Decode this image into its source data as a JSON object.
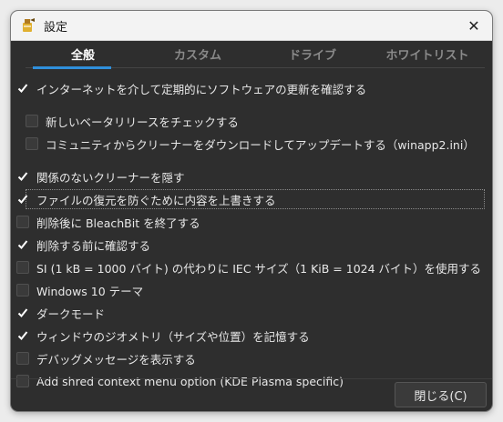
{
  "window": {
    "title": "設定",
    "close_glyph": "✕"
  },
  "tabs": [
    {
      "label": "全般",
      "active": true
    },
    {
      "label": "カスタム",
      "active": false
    },
    {
      "label": "ドライブ",
      "active": false
    },
    {
      "label": "ホワイトリスト",
      "active": false
    }
  ],
  "options": [
    {
      "label": "インターネットを介して定期的にソフトウェアの更新を確認する",
      "checked": true
    },
    {
      "label": "新しいベータリリースをチェックする",
      "checked": false
    },
    {
      "label": "コミュニティからクリーナーをダウンロードしてアップデートする（winapp2.ini）",
      "checked": false
    },
    {
      "label": "関係のないクリーナーを隠す",
      "checked": true
    },
    {
      "label": "ファイルの復元を防ぐために内容を上書きする",
      "checked": true
    },
    {
      "label": "削除後に BleachBit を終了する",
      "checked": false
    },
    {
      "label": "削除する前に確認する",
      "checked": true
    },
    {
      "label": "SI (1 kB = 1000 バイト) の代わりに IEC サイズ（1 KiB = 1024 バイト）を使用する",
      "checked": false
    },
    {
      "label": "Windows 10 テーマ",
      "checked": false
    },
    {
      "label": "ダークモード",
      "checked": true
    },
    {
      "label": "ウィンドウのジオメトリ（サイズや位置）を記憶する",
      "checked": true
    },
    {
      "label": "デバッグメッセージを表示する",
      "checked": false
    },
    {
      "label": "Add shred context menu option (KDE Plasma specific)",
      "checked": false
    }
  ],
  "footer": {
    "close_label": "閉じる(C)"
  },
  "colors": {
    "accent": "#2f8fdb",
    "background": "#2e2e2e",
    "text": "#e8e8e8"
  }
}
